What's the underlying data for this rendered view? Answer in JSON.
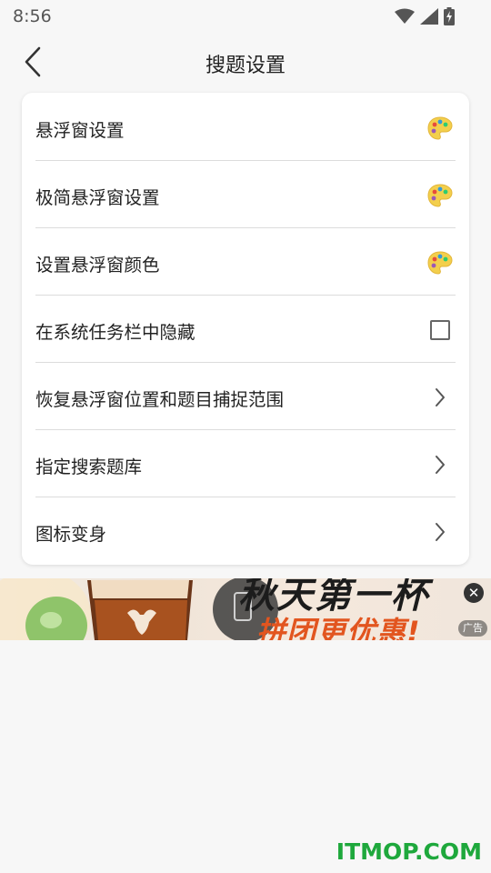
{
  "status_bar": {
    "time": "8:56",
    "icons": [
      "wifi-icon",
      "signal-icon",
      "battery-charging-icon"
    ]
  },
  "header": {
    "title": "搜题设置",
    "back_icon": "back-arrow-icon"
  },
  "settings": {
    "items": [
      {
        "label": "悬浮窗设置",
        "trail": "palette-icon"
      },
      {
        "label": "极简悬浮窗设置",
        "trail": "palette-icon"
      },
      {
        "label": "设置悬浮窗颜色",
        "trail": "palette-icon"
      },
      {
        "label": "在系统任务栏中隐藏",
        "trail": "checkbox",
        "checked": false
      },
      {
        "label": "恢复悬浮窗位置和题目捕捉范围",
        "trail": "chevron-right-icon"
      },
      {
        "label": "指定搜索题库",
        "trail": "chevron-right-icon"
      },
      {
        "label": "图标变身",
        "trail": "chevron-right-icon"
      }
    ]
  },
  "ad": {
    "headline_top": "秋天第一杯",
    "headline_main": "拼团更优惠!",
    "tag": "广告",
    "close_icon": "close-icon"
  },
  "watermark": {
    "text": "ITMOP.COM"
  },
  "colors": {
    "background": "#f7f7f7",
    "card": "#ffffff",
    "divider": "#dcdcdc",
    "ad_accent": "#e2551f",
    "watermark": "#1ea83c"
  }
}
